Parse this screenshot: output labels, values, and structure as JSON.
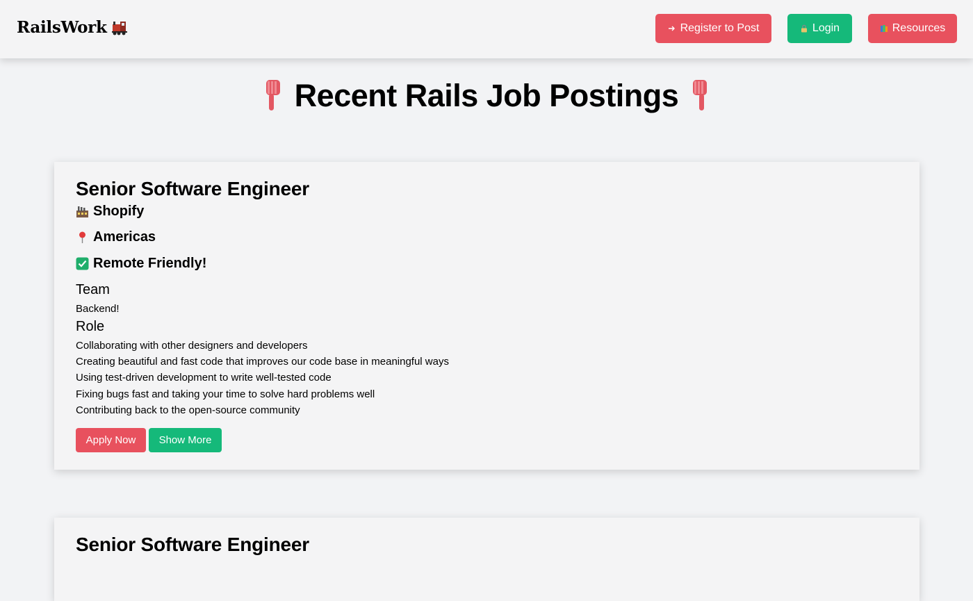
{
  "brand": {
    "name": "RailsWork"
  },
  "nav": {
    "register_label": "Register to Post",
    "login_label": "Login",
    "resources_label": "Resources"
  },
  "headline": {
    "text": "Recent Rails Job Postings"
  },
  "jobs": [
    {
      "title": "Senior Software Engineer",
      "company": "Shopify",
      "location": "Americas",
      "remote": "Remote Friendly!",
      "team_heading": "Team",
      "team": "Backend!",
      "role_heading": "Role",
      "role_lines": [
        "Collaborating with other designers and developers",
        "Creating beautiful and fast code that improves our code base in meaningful ways",
        "Using test-driven development to write well-tested code",
        "Fixing bugs fast and taking your time to solve hard problems well",
        "Contributing back to the open-source community"
      ],
      "apply_label": "Apply Now",
      "more_label": "Show More"
    },
    {
      "title": "Senior Software Engineer"
    }
  ],
  "colors": {
    "primary_red": "#e8515e",
    "primary_green": "#15b97a",
    "page_bg": "#f2f3f5"
  }
}
